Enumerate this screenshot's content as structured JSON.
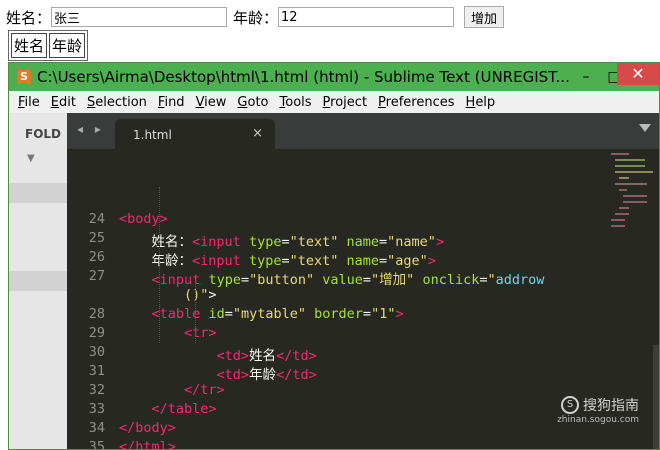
{
  "form": {
    "name_label": "姓名：",
    "name_value": "张三",
    "age_label": "年龄：",
    "age_value": "12",
    "add_button": "增加"
  },
  "table": {
    "cells": [
      "姓名",
      "年龄"
    ]
  },
  "window": {
    "title": "C:\\Users\\Airma\\Desktop\\html\\1.html (html) - Sublime Text (UNREGIST...",
    "app_icon": "sublime-logo-icon",
    "minimize": "–",
    "maximize": "□",
    "close": "✕"
  },
  "menu": [
    "File",
    "Edit",
    "Selection",
    "Find",
    "View",
    "Goto",
    "Tools",
    "Project",
    "Preferences",
    "Help"
  ],
  "sidebar": {
    "folders_label": "FOLD"
  },
  "tab": {
    "label": "1.html",
    "close": "×",
    "nav": "◂ ▸"
  },
  "editor": {
    "line_numbers": [
      "24",
      "25",
      "26",
      "27",
      "",
      "28",
      "29",
      "30",
      "31",
      "32",
      "33",
      "34",
      "35"
    ],
    "lines": [
      [
        [
          "tg",
          "<"
        ],
        [
          "tg",
          "body"
        ],
        [
          "tg",
          ">"
        ]
      ],
      [
        [
          "pl",
          "    姓名："
        ],
        [
          "tg",
          "<input"
        ],
        [
          "pl",
          " "
        ],
        [
          "at",
          "type"
        ],
        [
          "pl",
          "="
        ],
        [
          "st",
          "\"text\""
        ],
        [
          "pl",
          " "
        ],
        [
          "at",
          "name"
        ],
        [
          "pl",
          "="
        ],
        [
          "st",
          "\"name\""
        ],
        [
          "tg",
          ">"
        ]
      ],
      [
        [
          "pl",
          "    年龄："
        ],
        [
          "tg",
          "<input"
        ],
        [
          "pl",
          " "
        ],
        [
          "at",
          "type"
        ],
        [
          "pl",
          "="
        ],
        [
          "st",
          "\"text\""
        ],
        [
          "pl",
          " "
        ],
        [
          "at",
          "name"
        ],
        [
          "pl",
          "="
        ],
        [
          "st",
          "\"age\""
        ],
        [
          "tg",
          ">"
        ]
      ],
      [
        [
          "pl",
          "    "
        ],
        [
          "tg",
          "<input"
        ],
        [
          "pl",
          " "
        ],
        [
          "at",
          "type"
        ],
        [
          "pl",
          "="
        ],
        [
          "st",
          "\"button\""
        ],
        [
          "pl",
          " "
        ],
        [
          "at",
          "value"
        ],
        [
          "pl",
          "="
        ],
        [
          "st",
          "\"增加\""
        ],
        [
          "pl",
          " "
        ],
        [
          "at",
          "onclick"
        ],
        [
          "pl",
          "="
        ],
        [
          "st",
          "\""
        ],
        [
          "bl",
          "addrow"
        ]
      ],
      [
        [
          "pl",
          "        "
        ],
        [
          "st",
          "()\""
        ],
        [
          "pl",
          ">"
        ]
      ],
      [
        [
          "pl",
          "    "
        ],
        [
          "tg",
          "<table"
        ],
        [
          "pl",
          " "
        ],
        [
          "at",
          "id"
        ],
        [
          "pl",
          "="
        ],
        [
          "st",
          "\"mytable\""
        ],
        [
          "pl",
          " "
        ],
        [
          "at",
          "border"
        ],
        [
          "pl",
          "="
        ],
        [
          "st",
          "\"1\""
        ],
        [
          "tg",
          ">"
        ]
      ],
      [
        [
          "pl",
          "        "
        ],
        [
          "tg",
          "<tr>"
        ]
      ],
      [
        [
          "pl",
          "            "
        ],
        [
          "tg",
          "<td>"
        ],
        [
          "pl",
          "姓名"
        ],
        [
          "tg",
          "</td>"
        ]
      ],
      [
        [
          "pl",
          "            "
        ],
        [
          "tg",
          "<td>"
        ],
        [
          "pl",
          "年龄"
        ],
        [
          "tg",
          "</td>"
        ]
      ],
      [
        [
          "pl",
          "        "
        ],
        [
          "tg",
          "</tr>"
        ]
      ],
      [
        [
          "pl",
          "    "
        ],
        [
          "tg",
          "</table>"
        ]
      ],
      [
        [
          "tg",
          "</body>"
        ]
      ],
      [
        [
          "tg",
          "</html>"
        ]
      ]
    ]
  },
  "watermark": {
    "brand": "搜狗指南",
    "url": "zhinan.sogou.com"
  }
}
